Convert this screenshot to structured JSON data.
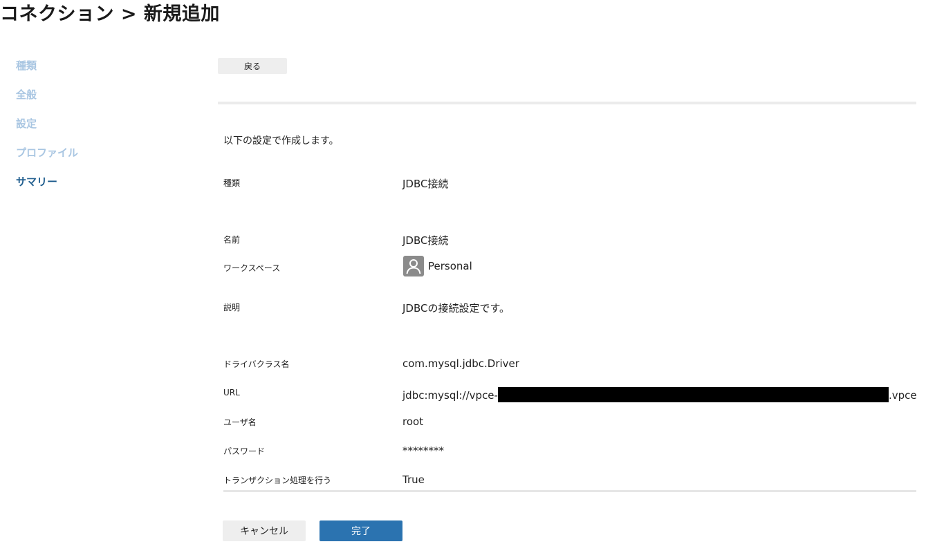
{
  "page": {
    "title": "コネクション > 新規追加"
  },
  "sidebar": {
    "items": [
      {
        "label": "種類"
      },
      {
        "label": "全般"
      },
      {
        "label": "設定"
      },
      {
        "label": "プロファイル"
      },
      {
        "label": "サマリー",
        "active": true
      }
    ]
  },
  "toolbar": {
    "back_label": "戻る"
  },
  "summary": {
    "intro": "以下の設定で作成します。",
    "type": {
      "label": "種類",
      "value": "JDBC接続"
    },
    "name": {
      "label": "名前",
      "value": "JDBC接続"
    },
    "workspace": {
      "label": "ワークスペース",
      "value": "Personal",
      "icon": "user-avatar-icon"
    },
    "description": {
      "label": "説明",
      "value": "JDBCの接続設定です。"
    },
    "driver": {
      "label": "ドライバクラス名",
      "value": "com.mysql.jdbc.Driver"
    },
    "url": {
      "label": "URL",
      "prefix": "jdbc:mysql://vpce-",
      "suffix": ".vpce"
    },
    "user": {
      "label": "ユーザ名",
      "value": "root"
    },
    "password": {
      "label": "パスワード",
      "value": "********"
    },
    "transaction": {
      "label": "トランザクション処理を行う",
      "value": "True"
    }
  },
  "actions": {
    "cancel_label": "キャンセル",
    "done_label": "完了"
  },
  "colors": {
    "accent": "#2b73b0",
    "sidebar_active": "#1f5d8e",
    "sidebar_inactive": "#a9c6e2",
    "button_bg": "#eeeeee",
    "redaction": "#000000"
  }
}
